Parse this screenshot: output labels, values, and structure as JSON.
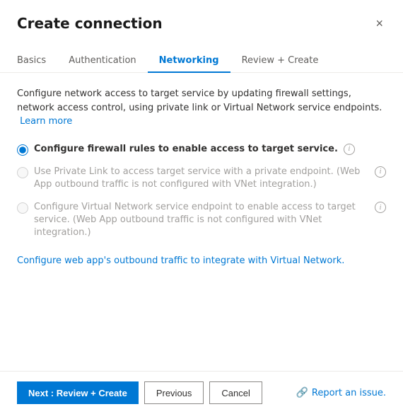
{
  "dialog": {
    "title": "Create connection",
    "close_label": "×"
  },
  "tabs": [
    {
      "id": "basics",
      "label": "Basics",
      "active": false
    },
    {
      "id": "authentication",
      "label": "Authentication",
      "active": false
    },
    {
      "id": "networking",
      "label": "Networking",
      "active": true
    },
    {
      "id": "review-create",
      "label": "Review + Create",
      "active": false
    }
  ],
  "content": {
    "description": "Configure network access to target service by updating firewall settings, network access control, using private link or Virtual Network service endpoints.",
    "learn_more_label": "Learn more",
    "options": [
      {
        "id": "firewall",
        "label": "Configure firewall rules to enable access to target service.",
        "bold": true,
        "disabled": false,
        "checked": true,
        "show_info": true
      },
      {
        "id": "private-link",
        "label": "Use Private Link to access target service with a private endpoint. (Web App outbound traffic is not configured with VNet integration.)",
        "bold": false,
        "disabled": true,
        "checked": false,
        "show_info": true
      },
      {
        "id": "vnet",
        "label": "Configure Virtual Network service endpoint to enable access to target service. (Web App outbound traffic is not configured with VNet integration.)",
        "bold": false,
        "disabled": true,
        "checked": false,
        "show_info": true
      }
    ],
    "outbound_link_label": "Configure web app's outbound traffic to integrate with Virtual Network."
  },
  "footer": {
    "next_label": "Next : Review + Create",
    "previous_label": "Previous",
    "cancel_label": "Cancel",
    "report_label": "Report an issue."
  }
}
